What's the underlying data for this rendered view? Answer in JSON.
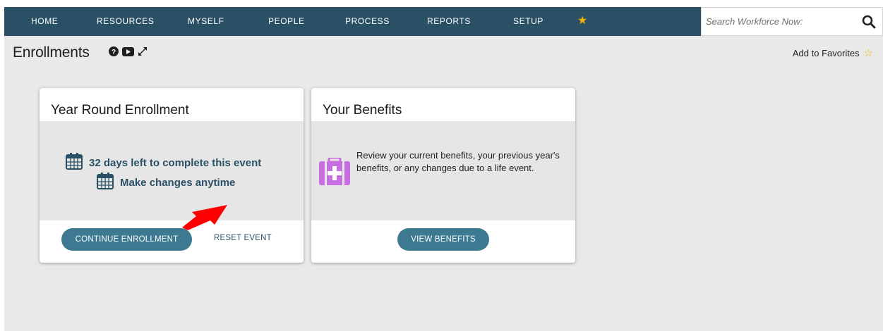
{
  "nav": {
    "items": [
      {
        "label": "HOME"
      },
      {
        "label": "RESOURCES"
      },
      {
        "label": "MYSELF"
      },
      {
        "label": "PEOPLE"
      },
      {
        "label": "PROCESS"
      },
      {
        "label": "REPORTS"
      },
      {
        "label": "SETUP"
      }
    ],
    "star_icon": "star-icon",
    "search": {
      "placeholder": "Search Workforce Now:",
      "value": "",
      "icon": "search-icon"
    }
  },
  "header": {
    "title": "Enrollments",
    "icons": [
      "help-icon",
      "video-icon",
      "expand-icon"
    ],
    "favorites_label": "Add to Favorites",
    "favorites_icon": "star-outline-icon"
  },
  "cards": {
    "enrollment": {
      "title": "Year Round Enrollment",
      "days_left": "32 days left to complete this event",
      "changes": "Make changes anytime",
      "icon": "calendar-icon",
      "continue_label": "CONTINUE ENROLLMENT",
      "reset_label": "RESET EVENT"
    },
    "benefits": {
      "title": "Your Benefits",
      "description": "Review your current benefits, your previous year's benefits, or any changes due to a life event.",
      "icon": "medical-kit-icon",
      "view_label": "VIEW BENEFITS"
    }
  },
  "colors": {
    "nav_bg": "#2a5065",
    "button_bg": "#3d7a91",
    "accent_text": "#2a5065",
    "star": "#f4b400",
    "medkit": "#c76fe0",
    "arrow": "#ff0000",
    "page_bg": "#e9e9e9"
  }
}
